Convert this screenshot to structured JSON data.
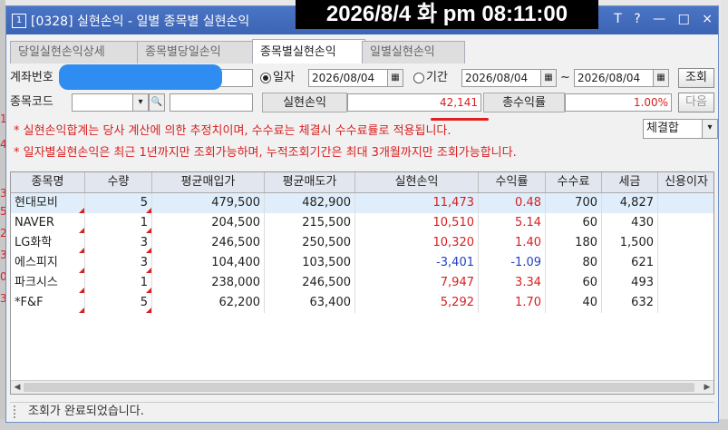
{
  "timestamp_overlay": "2026/8/4 화 pm 08:11:00",
  "window": {
    "number": "1",
    "title": "[0328] 실현손익 - 일별 종목별 실현손익",
    "buttons": [
      "T",
      "?",
      "—",
      "□",
      "×"
    ]
  },
  "tabs": [
    {
      "label": "당일실현손익상세",
      "active": false
    },
    {
      "label": "종목별당일손익",
      "active": false
    },
    {
      "label": "종목별실현손익",
      "active": true
    },
    {
      "label": "일별실현손익",
      "active": false
    }
  ],
  "form": {
    "account_label": "계좌번호",
    "radio_date_label": "일자",
    "date_value": "2026/08/04",
    "radio_period_label": "기간",
    "period_from": "2026/08/04",
    "period_sep": "~",
    "period_to": "2026/08/04",
    "query_button": "조회",
    "stock_code_label": "종목코드",
    "realized_label": "실현손익",
    "realized_value": "42,141",
    "return_label": "총수익률",
    "return_value": "1.00%",
    "next_button": "다음",
    "settle_select": "체결합"
  },
  "notices": [
    "* 실현손익합계는 당사 계산에 의한 추정치이며, 수수료는 체결시 수수료률로 적용됩니다.",
    "* 일자별실현손익은 최근 1년까지만 조회가능하며, 누적조회기간은 최대 3개월까지만 조회가능합니다."
  ],
  "table": {
    "headers": [
      "종목명",
      "수량",
      "평균매입가",
      "평균매도가",
      "실현손익",
      "수익률",
      "수수료",
      "세금",
      "신용이자"
    ],
    "rows": [
      {
        "name": "현대모비",
        "qty": "5",
        "buy": "479,500",
        "sell": "482,900",
        "pnl": "11,473",
        "rate": "0.48",
        "fee": "700",
        "tax": "4,827",
        "sign": "pos"
      },
      {
        "name": "NAVER",
        "qty": "1",
        "buy": "204,500",
        "sell": "215,500",
        "pnl": "10,510",
        "rate": "5.14",
        "fee": "60",
        "tax": "430",
        "sign": "pos"
      },
      {
        "name": "LG화학",
        "qty": "3",
        "buy": "246,500",
        "sell": "250,500",
        "pnl": "10,320",
        "rate": "1.40",
        "fee": "180",
        "tax": "1,500",
        "sign": "pos"
      },
      {
        "name": "에스피지",
        "qty": "3",
        "buy": "104,400",
        "sell": "103,500",
        "pnl": "-3,401",
        "rate": "-1.09",
        "fee": "80",
        "tax": "621",
        "sign": "neg"
      },
      {
        "name": "파크시스",
        "qty": "1",
        "buy": "238,000",
        "sell": "246,500",
        "pnl": "7,947",
        "rate": "3.34",
        "fee": "60",
        "tax": "493",
        "sign": "pos"
      },
      {
        "name": "*F&F",
        "qty": "5",
        "buy": "62,200",
        "sell": "63,400",
        "pnl": "5,292",
        "rate": "1.70",
        "fee": "40",
        "tax": "632",
        "sign": "pos"
      }
    ]
  },
  "status": "조회가 완료되었습니다.",
  "colors": {
    "title_bar": "#3c64b4",
    "profit": "#d82020",
    "loss": "#2040c8",
    "mask": "#2f8cf0"
  }
}
